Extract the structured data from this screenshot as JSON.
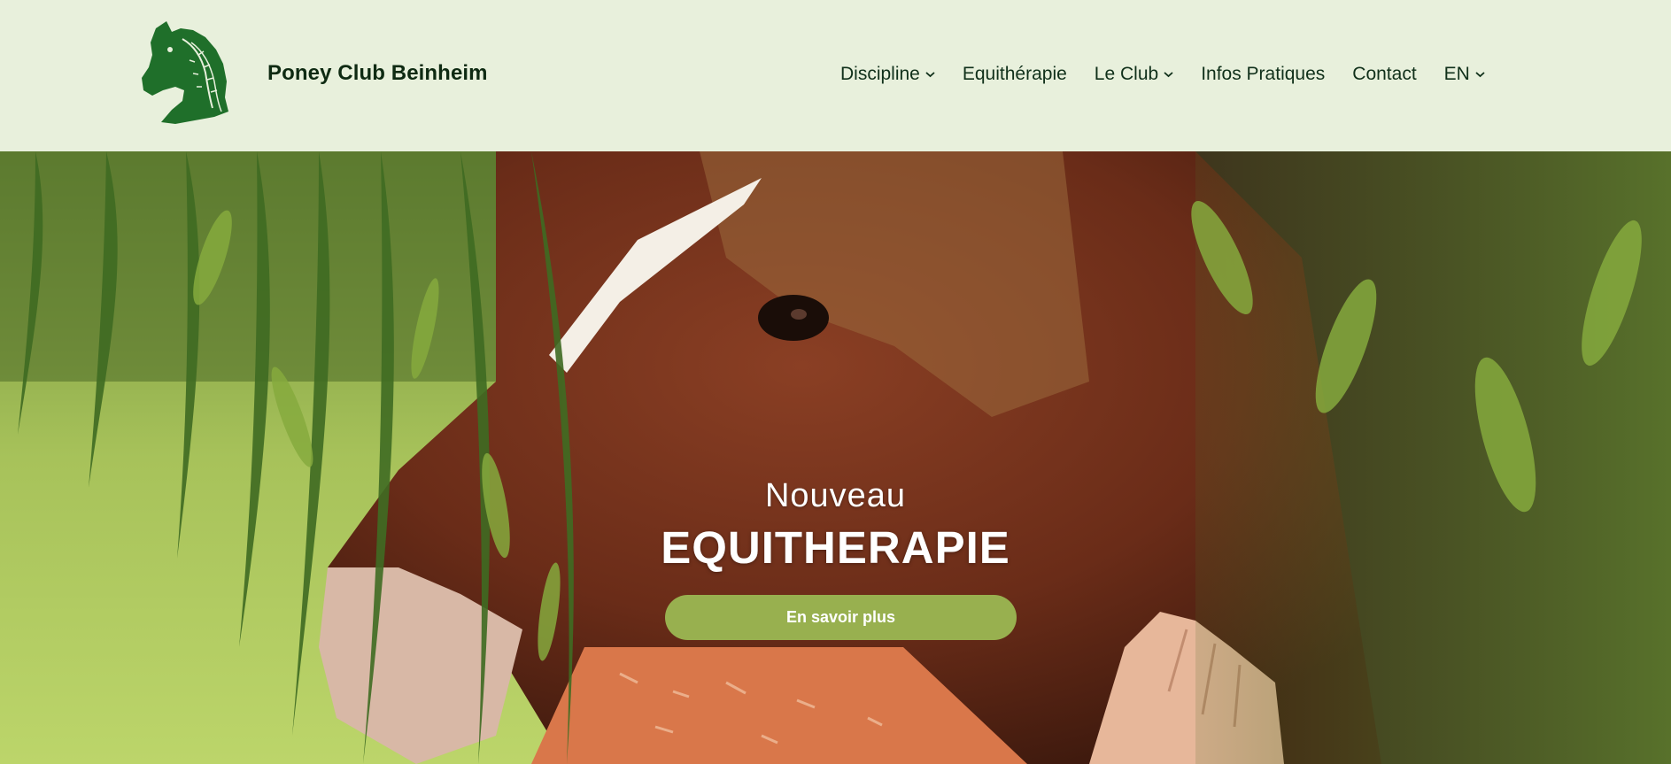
{
  "header": {
    "site_name": "Poney Club Beinheim",
    "logo_icon": "horse-head-logo-icon"
  },
  "nav": {
    "items": [
      {
        "label": "Discipline",
        "has_dropdown": true
      },
      {
        "label": "Equithérapie",
        "has_dropdown": false
      },
      {
        "label": "Le Club",
        "has_dropdown": true
      },
      {
        "label": "Infos Pratiques",
        "has_dropdown": false
      },
      {
        "label": "Contact",
        "has_dropdown": false
      },
      {
        "label": "EN",
        "has_dropdown": true
      }
    ]
  },
  "hero": {
    "eyebrow": "Nouveau",
    "title": "EQUITHERAPIE",
    "cta_label": "En savoir plus"
  },
  "colors": {
    "header_bg": "#e8f0dc",
    "brand_green": "#1f6f2a",
    "cta_green": "#98b04f",
    "text_dark": "#10301a"
  }
}
